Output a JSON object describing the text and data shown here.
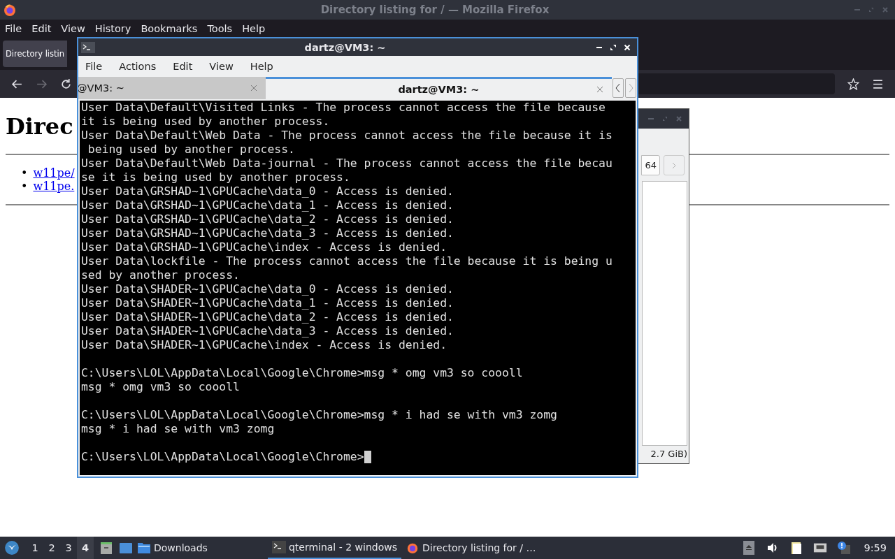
{
  "firefox": {
    "title": "Directory listing for / — Mozilla Firefox",
    "menu": [
      "File",
      "Edit",
      "View",
      "History",
      "Bookmarks",
      "Tools",
      "Help"
    ],
    "tab": {
      "label": "Directory listin"
    },
    "forward_disabled": true,
    "page": {
      "heading": "Direc",
      "links": [
        {
          "marker": "•",
          "label": "w11pe/"
        },
        {
          "marker": "•",
          "label": "w11pe."
        }
      ]
    }
  },
  "file_manager": {
    "path_button": "64",
    "status": "2.7 GiB)"
  },
  "terminal": {
    "title": "dartz@VM3: ~",
    "menu": [
      "File",
      "Actions",
      "Edit",
      "View",
      "Help"
    ],
    "tabs": [
      {
        "label": "@VM3: ~",
        "selected": false
      },
      {
        "label": "dartz@VM3: ~",
        "selected": true
      }
    ],
    "blocks": [
      [
        "User Data\\Default\\Visited Links - The process cannot access the file because",
        "it is being used by another process.",
        "User Data\\Default\\Web Data - The process cannot access the file because it is",
        " being used by another process.",
        "User Data\\Default\\Web Data-journal - The process cannot access the file becau",
        "se it is being used by another process.",
        "User Data\\GRSHAD~1\\GPUCache\\data_0 - Access is denied.",
        "User Data\\GRSHAD~1\\GPUCache\\data_1 - Access is denied.",
        "User Data\\GRSHAD~1\\GPUCache\\data_2 - Access is denied.",
        "User Data\\GRSHAD~1\\GPUCache\\data_3 - Access is denied.",
        "User Data\\GRSHAD~1\\GPUCache\\index - Access is denied.",
        "User Data\\lockfile - The process cannot access the file because it is being u",
        "sed by another process.",
        "User Data\\SHADER~1\\GPUCache\\data_0 - Access is denied.",
        "User Data\\SHADER~1\\GPUCache\\data_1 - Access is denied.",
        "User Data\\SHADER~1\\GPUCache\\data_2 - Access is denied.",
        "User Data\\SHADER~1\\GPUCache\\data_3 - Access is denied.",
        "User Data\\SHADER~1\\GPUCache\\index - Access is denied."
      ],
      [
        "C:\\Users\\LOL\\AppData\\Local\\Google\\Chrome>msg * omg vm3 so coooll",
        "msg * omg vm3 so coooll"
      ],
      [
        "C:\\Users\\LOL\\AppData\\Local\\Google\\Chrome>msg * i had se with vm3 zomg",
        "msg * i had se with vm3 zomg"
      ],
      [
        "C:\\Users\\LOL\\AppData\\Local\\Google\\Chrome>"
      ]
    ]
  },
  "taskbar": {
    "desktops": [
      {
        "label": "1",
        "selected": false
      },
      {
        "label": "2",
        "selected": false
      },
      {
        "label": "3",
        "selected": false
      },
      {
        "label": "4",
        "selected": true
      }
    ],
    "tasks": [
      {
        "kind": "folder",
        "label": "Downloads",
        "selected": false
      },
      {
        "kind": "terminal",
        "label": "qterminal - 2 windows",
        "selected": true
      },
      {
        "kind": "browser",
        "label": "Directory listing for / …",
        "selected": false
      }
    ],
    "clock": "9:59"
  }
}
